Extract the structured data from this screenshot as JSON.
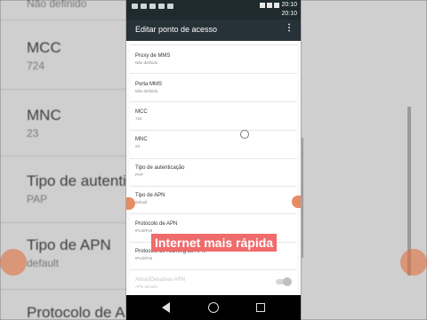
{
  "background": {
    "left_items": [
      {
        "title": "",
        "subtitle": "Não definido"
      },
      {
        "title": "MCC",
        "subtitle": "724"
      },
      {
        "title": "MNC",
        "subtitle": "23"
      },
      {
        "title": "Tipo de autentica",
        "subtitle": "PAP"
      },
      {
        "title": "Tipo de APN",
        "subtitle": "default"
      },
      {
        "title": "Protocolo de APN",
        "subtitle": ""
      }
    ]
  },
  "status_bar": {
    "time_top": "20:10",
    "time_bottom": "20:10"
  },
  "app_bar": {
    "title": "Editar ponto de acesso",
    "more_glyph": "⋮"
  },
  "settings": [
    {
      "title": "Proxy de MMS",
      "value": "Não definido"
    },
    {
      "title": "Porta MMS",
      "value": "Não definido"
    },
    {
      "title": "MCC",
      "value": "724"
    },
    {
      "title": "MNC",
      "value": "23"
    },
    {
      "title": "Tipo de autenticação",
      "value": "PAP"
    },
    {
      "title": "Tipo de APN",
      "value": "default"
    },
    {
      "title": "Protocolo de APN",
      "value": "IPv4/IPv6"
    },
    {
      "title": "Protocolo de roaming do APN",
      "value": "IPv4/IPv6"
    },
    {
      "title": "Ativar/Desativar APN",
      "value": "APN ativado"
    }
  ],
  "caption": "Internet mais rápida",
  "colors": {
    "app_bar": "#263238",
    "status_bar": "#1e2a2e",
    "caption_bg": "#f06b6b",
    "accent_dot": "#e07040"
  }
}
